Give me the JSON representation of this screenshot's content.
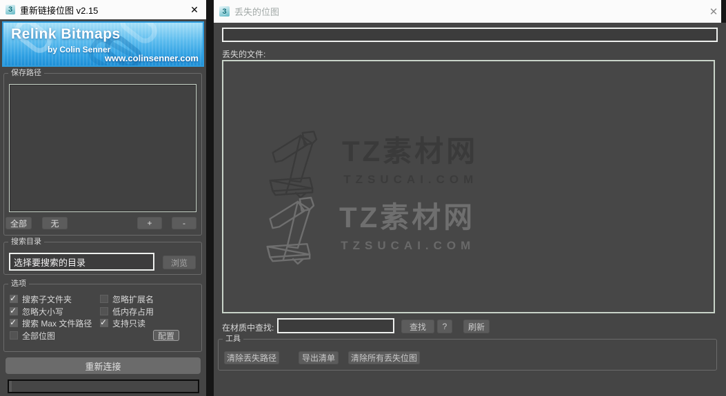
{
  "icons": {
    "app_glyph": "3",
    "close_glyph": "✕"
  },
  "left_window": {
    "title": "重新链接位图 v2.15",
    "banner": {
      "title": "Relink Bitmaps",
      "byline": "by Colin Senner",
      "url": "www.colinsenner.com"
    },
    "save_paths": {
      "label": "保存路径",
      "all_button": "全部",
      "none_button": "无",
      "add_button": "+",
      "remove_button": "-"
    },
    "search_dir": {
      "label": "搜索目录",
      "input_value": "选择要搜索的目录",
      "browse_button": "浏览"
    },
    "options": {
      "label": "选项",
      "checkboxes": [
        {
          "label": "搜索子文件夹",
          "checked": true
        },
        {
          "label": "忽略大小写",
          "checked": true
        },
        {
          "label": "搜索 Max 文件路径",
          "checked": true
        },
        {
          "label": "全部位图",
          "checked": false
        },
        {
          "label": "忽略扩展名",
          "checked": false
        },
        {
          "label": "低内存占用",
          "checked": false
        },
        {
          "label": "支持只读",
          "checked": true
        }
      ],
      "config_button": "配置"
    },
    "relink_button": "重新连接"
  },
  "right_window": {
    "title": "丢失的位图",
    "path_field_value": "",
    "missing_files_label": "丢失的文件:",
    "find_label": "在材质中查找:",
    "find_input_value": "",
    "find_button": "查找",
    "help_button": "?",
    "refresh_button": "刷新",
    "tools": {
      "label": "工具",
      "buttons": [
        "清除丢失路径",
        "导出清单",
        "清除所有丢失位图"
      ]
    },
    "watermark": {
      "brand": "TZ素材网",
      "domain": "TZSUCAI.COM"
    }
  },
  "colors": {
    "accent_blue": "#2d9fe2",
    "window_bg": "#454545",
    "titlebar_bg": "#fbfbfb",
    "field_border": "#eef0ee",
    "list_border": "#c9d4c9",
    "button_bg": "#5c5c5c",
    "watermark_dark": "#3a3a3a",
    "watermark_light": "#6f6f6f"
  }
}
